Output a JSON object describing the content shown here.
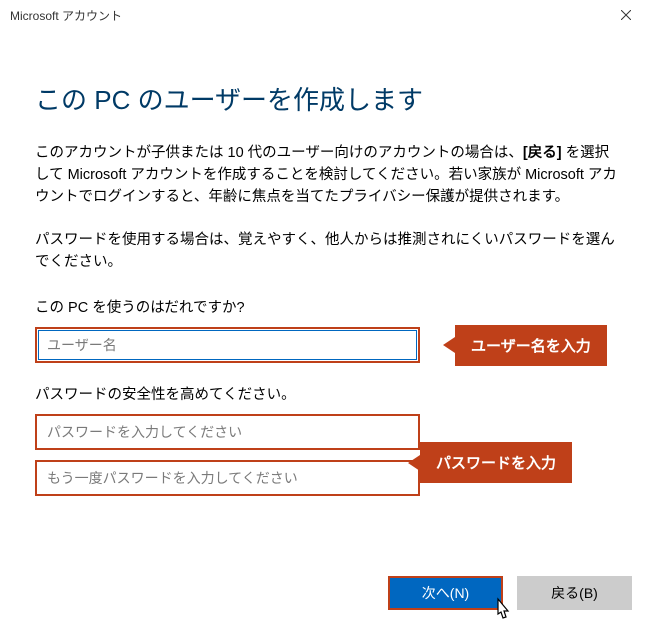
{
  "titlebar": {
    "title": "Microsoft アカウント"
  },
  "heading": "この PC のユーザーを作成します",
  "paragraph1_pre": "このアカウントが子供または 10 代のユーザー向けのアカウントの場合は、",
  "paragraph1_bold": "[戻る]",
  "paragraph1_post": " を選択して Microsoft アカウントを作成することを検討してください。若い家族が Microsoft アカウントでログインすると、年齢に焦点を当てたプライバシー保護が提供されます。",
  "paragraph2": "パスワードを使用する場合は、覚えやすく、他人からは推測されにくいパスワードを選んでください。",
  "username_section": {
    "label": "この PC を使うのはだれですか?",
    "placeholder": "ユーザー名"
  },
  "password_section": {
    "label": "パスワードの安全性を高めてください。",
    "placeholder1": "パスワードを入力してください",
    "placeholder2": "もう一度パスワードを入力してください"
  },
  "callouts": {
    "username": "ユーザー名を入力",
    "password": "パスワードを入力"
  },
  "buttons": {
    "next": "次へ(N)",
    "back": "戻る(B)"
  }
}
